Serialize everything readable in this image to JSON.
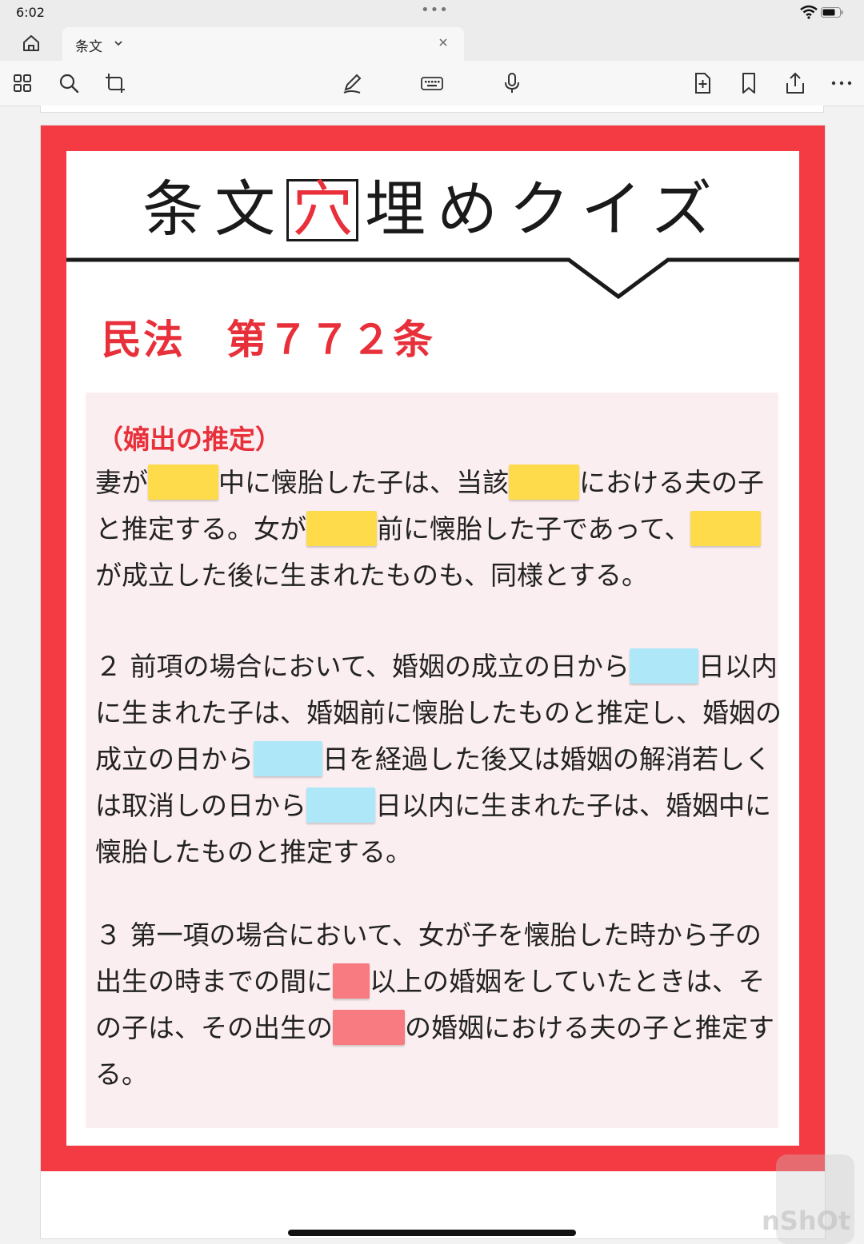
{
  "status": {
    "time": "6:02"
  },
  "tab": {
    "label": "条文"
  },
  "icons": {
    "home": "home-icon",
    "chevron": "chevron-down-icon",
    "close": "close-icon",
    "grid": "grid-icon",
    "search": "search-icon",
    "crop": "crop-icon",
    "pen": "pen-icon",
    "keyboard": "keyboard-icon",
    "mic": "microphone-icon",
    "add_page": "add-page-icon",
    "bookmark": "bookmark-icon",
    "share": "share-icon",
    "more": "more-icon"
  },
  "doc": {
    "title_before": "条文",
    "title_box": "穴",
    "title_after": "埋めクイズ",
    "article": "民法　第７７２条",
    "heading": "（嫡出の推定）",
    "p1": {
      "a": "妻が",
      "b": "中に懐胎した子は、当該",
      "c": "における夫の子と推定する。女が",
      "d": "前に懐胎した子であって、",
      "e": "が成立した後に生まれたものも、同様とする。"
    },
    "p2": {
      "a": "２ 前項の場合において、婚姻の成立の日から",
      "b": "日以内に生まれた子は、婚姻前に懐胎したものと推定し、婚姻の成立の日から",
      "c": "日を経過した後又は婚姻の解消若しくは取消しの日から",
      "d": "日以内に生まれた子は、婚姻中に懐胎したものと推定する。"
    },
    "p3": {
      "a": "３ 第一項の場合において、女が子を懐胎した時から子の出生の時までの間に",
      "b": "以上の婚姻をしていたときは、その子は、その出生の",
      "c": "の婚姻における夫の子と推定する。"
    }
  },
  "colors": {
    "frame": "#f43a42",
    "accent": "#e8303a",
    "blank_yellow": "#fddb4a",
    "blank_blue": "#aee8f8",
    "blank_red": "#f77b80"
  },
  "watermark": "nShOt"
}
